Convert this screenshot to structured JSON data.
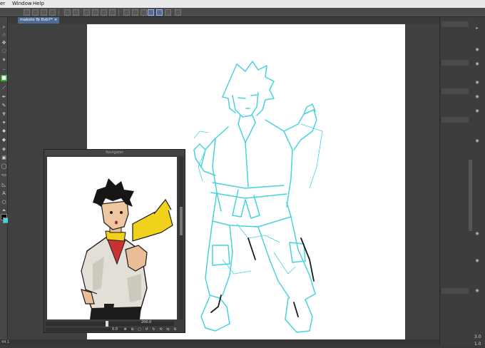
{
  "menu": {
    "items": [
      "er",
      "Window",
      "Help"
    ]
  },
  "tabs": {
    "document": "makoto fb 8vb7*",
    "close_glyph": "×"
  },
  "navigator": {
    "title": "Navigator",
    "zoom_value": "200.0",
    "angle_value": "0.0"
  },
  "tools": {
    "icons": [
      "search-icon",
      "move-icon",
      "hand-icon",
      "rotate-icon",
      "lasso-icon",
      "wand-icon",
      "select-icon",
      "eyedropper-icon",
      "pen-icon",
      "pencil-icon",
      "brush-icon",
      "airbrush-icon",
      "decoration-icon",
      "eraser-icon",
      "fill-icon",
      "gradient-icon",
      "figure-icon",
      "frame-icon",
      "ruler-icon",
      "text-icon",
      "balloon-icon",
      "correct-line-icon"
    ]
  },
  "colors": {
    "main_color": "#0a0a0a",
    "sub_color": "#3fd7e0",
    "line_cyan": "#45d3dd",
    "selected_tool": "#3fae3f"
  },
  "right_panel": {
    "readout_1": "3.0",
    "readout_2": "1.0"
  },
  "status": {
    "zoom": "44.1"
  }
}
